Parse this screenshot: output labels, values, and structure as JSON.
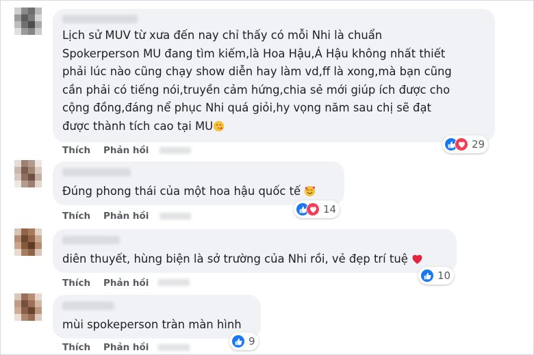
{
  "colors": {
    "bubble": "#f0f2f5",
    "like": "#1877f2",
    "love": "#f33e58",
    "text": "#1c1e21",
    "meta": "#575a5f"
  },
  "comments": [
    {
      "text": "Lịch sử MUV từ xưa đến nay chỉ thấy có mỗi Nhi là chuẩn\nSpokerperson MU đang tìm kiếm,là Hoa Hậu,Á Hậu không nhất thiết\nphải lúc nào cũng chạy show diễn hay làm vd,ff là xong,mà bạn cũng\ncần phải có tiếng nói,truyền cảm hứng,chia sẻ mới giúp ích được cho\ncộng đồng,đáng nể phục Nhi quá giỏi,hy vọng năm sau chị sẽ đạt\nđược thành tích cao tại MU",
      "emoji": "kiss-face",
      "like_label": "Thích",
      "reply_label": "Phản hồi",
      "reactions": [
        "like",
        "love"
      ],
      "reaction_count": "29"
    },
    {
      "text": "Đúng phong thái của một hoa hậu quốc tế",
      "emoji": "smiling-face-with-hearts",
      "like_label": "Thích",
      "reply_label": "Phản hồi",
      "reactions": [
        "like",
        "love"
      ],
      "reaction_count": "14"
    },
    {
      "text": "diên thuyết, hùng biện là sở trường của Nhi rồi, vẻ đẹp trí tuệ",
      "emoji": "red-heart",
      "like_label": "Thích",
      "reply_label": "Phản hồi",
      "reactions": [
        "like"
      ],
      "reaction_count": "10"
    },
    {
      "text": "mùi spokeperson tràn màn hình",
      "emoji": "",
      "like_label": "Thích",
      "reply_label": "Phản hồi",
      "reactions": [
        "like"
      ],
      "reaction_count": "9"
    }
  ]
}
